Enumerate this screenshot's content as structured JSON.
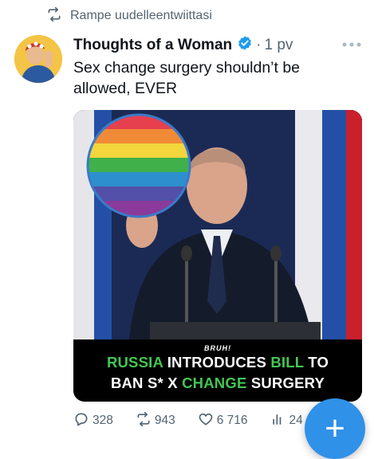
{
  "retweet": {
    "label": "Rampe uudelleentwiittasi"
  },
  "tweet": {
    "author_name": "Thoughts of a Woman",
    "separator": "·",
    "time": "1 pv",
    "text": "Sex change surgery shouldn’t be allowed, EVER"
  },
  "media": {
    "bruh_label": "BRUH!",
    "caption": {
      "line1_a": "RUSSIA",
      "line1_b": " INTRODUCES ",
      "line1_c": "BILL",
      "line1_d": " TO",
      "line2_a": "BAN S* X ",
      "line2_b": "CHANGE",
      "line2_c": " SURGERY"
    }
  },
  "actions": {
    "replies": "328",
    "retweets": "943",
    "likes": "6 716",
    "views": "24"
  },
  "compose": {
    "label": "+"
  },
  "colors": {
    "accent": "#1d9bf0",
    "fab": "#2f91e8",
    "caption_green": "#43c653",
    "muted": "#536471"
  },
  "icons": [
    "retweet-icon",
    "verified-badge-icon",
    "more-icon",
    "reply-icon",
    "like-icon",
    "views-icon",
    "compose-plus-icon"
  ]
}
